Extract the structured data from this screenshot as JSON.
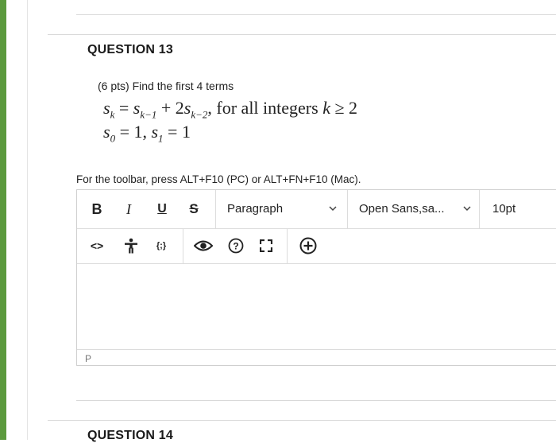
{
  "question13": {
    "title": "QUESTION 13",
    "intro": "(6 pts) Find the first 4 terms",
    "eq1": {
      "lhs": "s",
      "lhs_sub": "k",
      "eq": " = ",
      "t1": "s",
      "t1_sub": "k−1",
      "plus": " + 2",
      "t2": "s",
      "t2_sub": "k−2",
      "tail": ", for all integers ",
      "k": "k",
      "cond": " ≥ 2"
    },
    "eq2": {
      "a": "s",
      "a_sub": "0",
      "a_val": " = 1,  ",
      "b": "s",
      "b_sub": "1",
      "b_val": " = 1"
    }
  },
  "toolbar_hint": "For the toolbar, press ALT+F10 (PC) or ALT+FN+F10 (Mac).",
  "toolbar": {
    "bold": "B",
    "italic": "I",
    "underline": "U",
    "strike": "S",
    "paragraph": "Paragraph",
    "font": "Open Sans,sa...",
    "size": "10pt",
    "code": "<>",
    "braces": "{;}"
  },
  "status_bar": "P",
  "question14": {
    "title": "QUESTION 14"
  },
  "icons": [
    "bold-icon",
    "italic-icon",
    "underline-icon",
    "strikethrough-icon",
    "code-view-icon",
    "accessibility-icon",
    "equation-icon",
    "preview-icon",
    "help-icon",
    "fullscreen-icon",
    "add-content-icon"
  ],
  "colors": {
    "accent_green": "#5c9a3e"
  }
}
